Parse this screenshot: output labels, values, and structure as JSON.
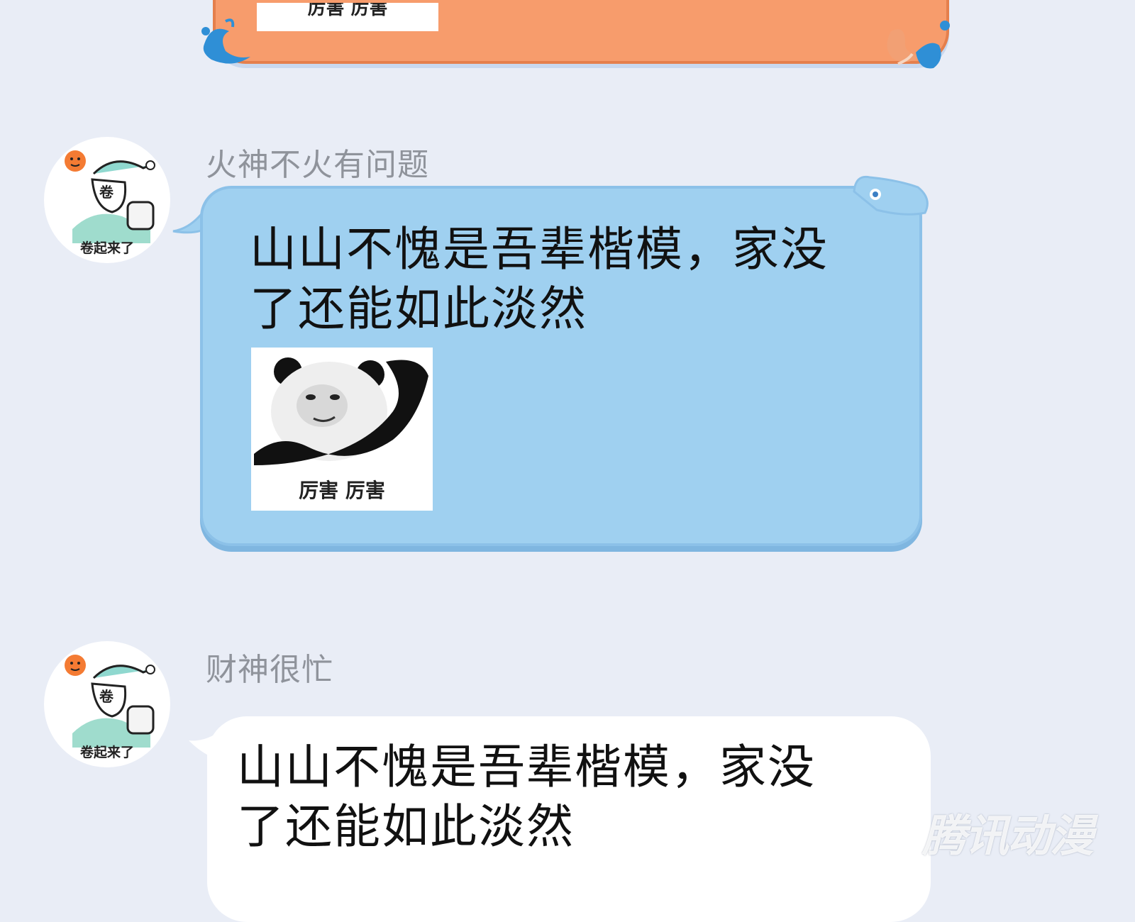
{
  "top_message": {
    "sticker_caption": "厉害 厉害"
  },
  "messages": [
    {
      "avatar_caption": "卷起来了",
      "avatar_glyph": "卷",
      "sender": "火神不火有问题",
      "text_line1": "山山不愧是吾辈楷模，家没",
      "text_line2": "了还能如此淡然",
      "sticker_caption": "厉害 厉害"
    },
    {
      "avatar_caption": "卷起来了",
      "avatar_glyph": "卷",
      "sender": "财神很忙",
      "text_line1": "山山不愧是吾辈楷模，家没",
      "text_line2": "了还能如此淡然"
    }
  ],
  "watermark": "腾讯动漫",
  "colors": {
    "background": "#e9edf6",
    "orange_bubble": "#f79c6c",
    "blue_bubble": "#9fd0f0",
    "white_bubble": "#ffffff",
    "sender_name": "#8f939b"
  }
}
